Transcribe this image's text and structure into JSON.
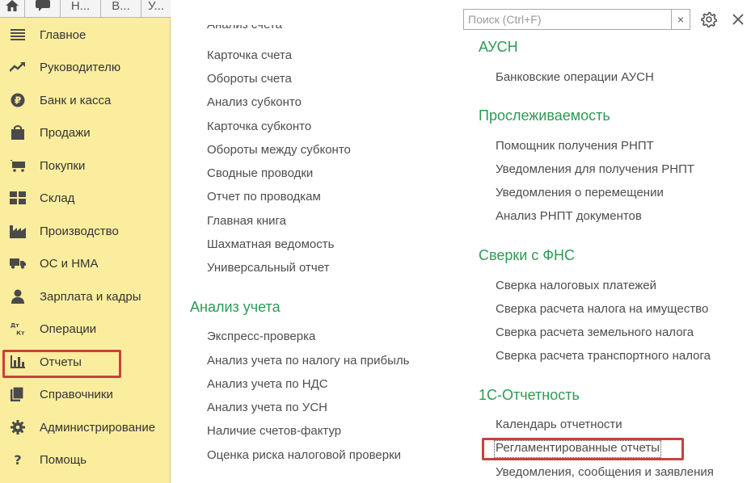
{
  "top_tabs": [
    "Н...",
    "В...",
    "У..."
  ],
  "sidebar": {
    "items": [
      {
        "label": "Главное",
        "icon": "menu-lines-icon"
      },
      {
        "label": "Руководителю",
        "icon": "trend-up-icon"
      },
      {
        "label": "Банк и касса",
        "icon": "ruble-coin-icon"
      },
      {
        "label": "Продажи",
        "icon": "shopping-bag-icon"
      },
      {
        "label": "Покупки",
        "icon": "cart-icon"
      },
      {
        "label": "Склад",
        "icon": "warehouse-grid-icon"
      },
      {
        "label": "Производство",
        "icon": "factory-icon"
      },
      {
        "label": "ОС и НМА",
        "icon": "truck-icon"
      },
      {
        "label": "Зарплата и кадры",
        "icon": "person-icon"
      },
      {
        "label": "Операции",
        "icon": "dt-kt-icon"
      },
      {
        "label": "Отчеты",
        "icon": "bar-chart-icon"
      },
      {
        "label": "Справочники",
        "icon": "books-icon"
      },
      {
        "label": "Администрирование",
        "icon": "gear-icon"
      },
      {
        "label": "Помощь",
        "icon": "question-icon"
      }
    ],
    "dt_kt": {
      "top": "Дт",
      "bottom": "Кт"
    }
  },
  "search": {
    "placeholder": "Поиск (Ctrl+F)",
    "clear": "×"
  },
  "left_column": {
    "top_cut": "Анализ счета",
    "reports": [
      "Карточка счета",
      "Обороты счета",
      "Анализ субконто",
      "Карточка субконто",
      "Обороты между субконто",
      "Сводные проводки",
      "Отчет по проводкам",
      "Главная книга",
      "Шахматная ведомость",
      "Универсальный отчет"
    ],
    "analysis_title": "Анализ учета",
    "analysis": [
      "Экспресс-проверка",
      "Анализ учета по налогу на прибыль",
      "Анализ учета по НДС",
      "Анализ учета по УСН",
      "Наличие счетов-фактур",
      "Оценка риска налоговой проверки"
    ]
  },
  "right_column": {
    "ausn_title": "АУСН",
    "ausn": [
      "Банковские операции АУСН"
    ],
    "trace_title": "Прослеживаемость",
    "trace": [
      "Помощник получения РНПТ",
      "Уведомления для получения РНПТ",
      "Уведомления о перемещении",
      "Анализ РНПТ документов"
    ],
    "fns_title": "Сверки с ФНС",
    "fns": [
      "Сверка налоговых платежей",
      "Сверка расчета налога на имущество",
      "Сверка расчета земельного налога",
      "Сверка расчета транспортного налога"
    ],
    "reporting_title": "1С-Отчетность",
    "reporting": [
      "Календарь отчетности",
      "Регламентированные отчеты",
      "Уведомления, сообщения и заявления"
    ]
  }
}
